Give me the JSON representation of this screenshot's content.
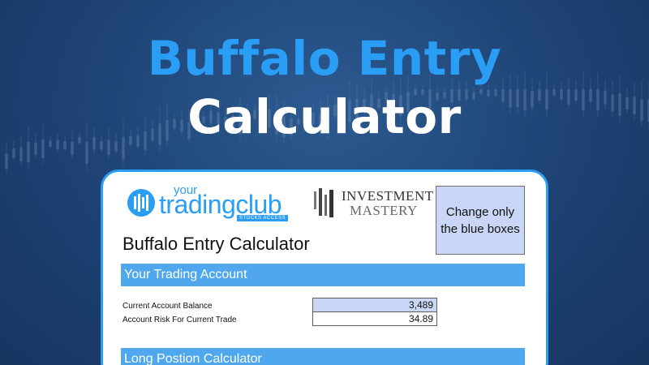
{
  "headline": {
    "line1": "Buffalo Entry",
    "line2": "Calculator"
  },
  "colors": {
    "accent_blue": "#2a9df4",
    "section_bar": "#4fa8ed",
    "input_cell": "#c9d6f5",
    "background": "#1d4273"
  },
  "logos": {
    "ytc": {
      "your": "your",
      "main": "tradingclub",
      "sub": "STOCKS ACCESS"
    },
    "im": {
      "line1": "INVESTMENT",
      "line2": "MASTERY"
    }
  },
  "sheet": {
    "note": "Change only the blue boxes",
    "title": "Buffalo Entry Calculator",
    "section_account": "Your Trading Account",
    "rows": [
      {
        "label": "Current Account Balance",
        "value": "3,489"
      },
      {
        "label": "Account Risk For Current Trade",
        "value": "34.89"
      }
    ],
    "section_long": "Long Postion Calculator"
  }
}
